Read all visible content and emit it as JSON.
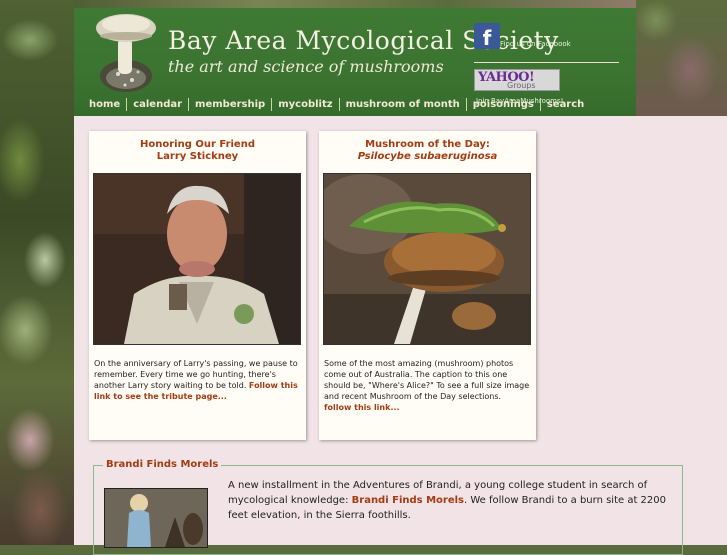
{
  "header": {
    "title": "Bay Area Mycological Society",
    "tagline": "the art and science of mushrooms",
    "facebook_icon": "f",
    "facebook_text": "Find us on Facebook",
    "yahoo_logo": "YAHOO!",
    "yahoo_groups": "Groups",
    "yahoo_text": "Join BayAreaMushrooms!"
  },
  "nav": {
    "items": [
      "home",
      "calendar",
      "membership",
      "mycoblitz",
      "mushroom of month",
      "poisonings",
      "search"
    ]
  },
  "card_left": {
    "title_line1": "Honoring Our Friend",
    "title_line2": "Larry Stickney",
    "body": "On the anniversary of Larry's passing, we pause to remember. Every time we go hunting, there's another Larry story waiting to be told. ",
    "link": "Follow this link to see the tribute page..."
  },
  "card_right": {
    "title_line1": "Mushroom of the Day:",
    "title_line2": "Psilocybe subaeruginosa",
    "body": "Some of the most amazing (mushroom) photos come out of Australia. The caption to this one should be, \"Where's Alice?\" To see a full size image and recent Mushroom of the Day selections. ",
    "link": "follow this link..."
  },
  "brandi": {
    "legend": "Brandi Finds Morels",
    "text_before": "A new installment in the Adventures of Brandi, a young college student in search of mycological knowledge: ",
    "link": "Brandi Finds Morels",
    "text_after": ". We follow Brandi to a burn site at 2200 feet elevation, in the Sierra foothills."
  },
  "colors": {
    "header_green": "#3f7a34",
    "link_rust": "#a33c12",
    "content_bg": "#f1e3e6"
  }
}
